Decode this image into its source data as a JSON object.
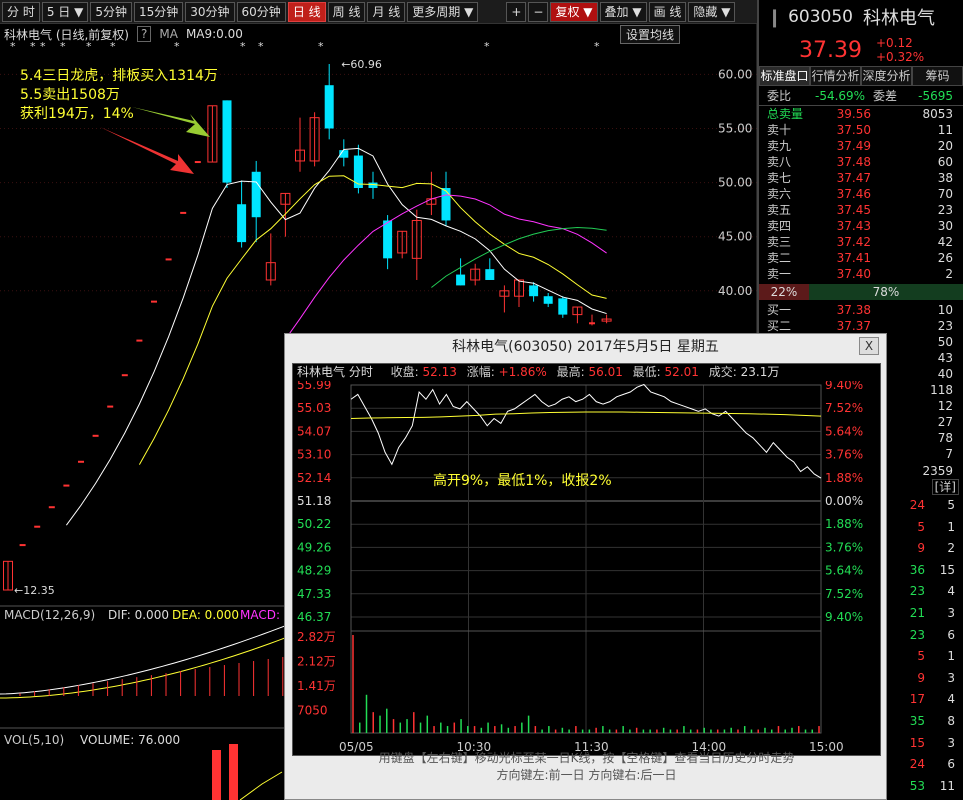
{
  "toolbar": {
    "items": [
      "分 时",
      "5 日",
      "5分钟",
      "15分钟",
      "30分钟",
      "60分钟",
      "日 线",
      "周 线",
      "月 线",
      "更多周期",
      "+",
      "−",
      "复权",
      "叠加",
      "画 线",
      "隐藏"
    ]
  },
  "chart_header": {
    "title": "科林电气 (日线,前复权)",
    "q": "?",
    "ma": "MA",
    "ma9": "MA9:0.00",
    "settings": "设置均线"
  },
  "annotation": {
    "line1": "5.4三日龙虎，排板买入1314万",
    "line2": "5.5卖出1508万",
    "line3": "获利194万，14%"
  },
  "chart_data": [
    {
      "type": "candlestick",
      "title": "科林电气 (日线,前复权)",
      "y_ticks": [
        "60.00",
        "55.00",
        "50.00",
        "45.00",
        "40.00"
      ],
      "ylim": [
        12.35,
        60.96
      ],
      "high_label": "60.96",
      "low_label": "12.35",
      "candles": [
        {
          "o": 12.35,
          "h": 15.0,
          "l": 12.35,
          "c": 15.0
        },
        {
          "o": 16.5,
          "h": 16.5,
          "l": 16.5,
          "c": 16.5
        },
        {
          "o": 18.2,
          "h": 18.2,
          "l": 18.2,
          "c": 18.2
        },
        {
          "o": 20.0,
          "h": 20.0,
          "l": 20.0,
          "c": 20.0
        },
        {
          "o": 22.0,
          "h": 22.0,
          "l": 22.0,
          "c": 22.0
        },
        {
          "o": 24.2,
          "h": 24.2,
          "l": 24.2,
          "c": 24.2
        },
        {
          "o": 26.6,
          "h": 26.6,
          "l": 26.6,
          "c": 26.6
        },
        {
          "o": 29.3,
          "h": 29.3,
          "l": 29.3,
          "c": 29.3
        },
        {
          "o": 32.2,
          "h": 32.2,
          "l": 32.2,
          "c": 32.2
        },
        {
          "o": 35.4,
          "h": 35.4,
          "l": 35.4,
          "c": 35.4
        },
        {
          "o": 39.0,
          "h": 39.0,
          "l": 39.0,
          "c": 39.0
        },
        {
          "o": 42.9,
          "h": 42.9,
          "l": 42.9,
          "c": 42.9
        },
        {
          "o": 47.2,
          "h": 47.2,
          "l": 47.2,
          "c": 47.2
        },
        {
          "o": 51.9,
          "h": 51.9,
          "l": 51.9,
          "c": 51.9
        },
        {
          "o": 51.9,
          "h": 57.1,
          "l": 51.9,
          "c": 57.1
        },
        {
          "o": 57.6,
          "h": 57.6,
          "l": 49.5,
          "c": 50.0
        },
        {
          "o": 48.0,
          "h": 50.2,
          "l": 44.0,
          "c": 44.5
        },
        {
          "o": 51.0,
          "h": 52.0,
          "l": 44.5,
          "c": 46.8
        },
        {
          "o": 41.0,
          "h": 45.3,
          "l": 40.5,
          "c": 42.6
        },
        {
          "o": 48.0,
          "h": 49.0,
          "l": 45.0,
          "c": 49.0
        },
        {
          "o": 52.0,
          "h": 56.0,
          "l": 51.0,
          "c": 53.0
        },
        {
          "o": 52.0,
          "h": 56.5,
          "l": 51.5,
          "c": 56.0
        },
        {
          "o": 59.0,
          "h": 60.96,
          "l": 54.0,
          "c": 55.0
        },
        {
          "o": 53.0,
          "h": 54.0,
          "l": 51.5,
          "c": 52.3
        },
        {
          "o": 52.5,
          "h": 53.5,
          "l": 49.0,
          "c": 49.5
        },
        {
          "o": 50.0,
          "h": 51.0,
          "l": 48.5,
          "c": 49.5
        },
        {
          "o": 46.5,
          "h": 47.0,
          "l": 42.0,
          "c": 43.0
        },
        {
          "o": 43.5,
          "h": 45.5,
          "l": 43.0,
          "c": 45.5
        },
        {
          "o": 43.0,
          "h": 47.5,
          "l": 41.0,
          "c": 46.5
        },
        {
          "o": 48.0,
          "h": 51.0,
          "l": 47.0,
          "c": 48.5
        },
        {
          "o": 49.5,
          "h": 51.0,
          "l": 46.0,
          "c": 46.5
        },
        {
          "o": 41.5,
          "h": 43.0,
          "l": 40.5,
          "c": 40.5
        },
        {
          "o": 41.0,
          "h": 42.5,
          "l": 40.5,
          "c": 42.0
        },
        {
          "o": 42.0,
          "h": 43.0,
          "l": 41.0,
          "c": 41.0
        },
        {
          "o": 39.5,
          "h": 40.5,
          "l": 38.0,
          "c": 40.0
        },
        {
          "o": 39.5,
          "h": 41.0,
          "l": 38.5,
          "c": 41.0
        },
        {
          "o": 40.5,
          "h": 40.8,
          "l": 39.0,
          "c": 39.5
        },
        {
          "o": 39.5,
          "h": 39.8,
          "l": 38.5,
          "c": 38.8
        },
        {
          "o": 39.3,
          "h": 39.5,
          "l": 37.5,
          "c": 37.8
        },
        {
          "o": 37.8,
          "h": 38.5,
          "l": 37.0,
          "c": 38.5
        },
        {
          "o": 37.0,
          "h": 37.8,
          "l": 36.8,
          "c": 37.0
        },
        {
          "o": 37.2,
          "h": 37.8,
          "l": 37.0,
          "c": 37.39
        }
      ]
    },
    {
      "type": "line",
      "title": "MACD(12,26,9)",
      "dif": "0.000",
      "dea": "0.000",
      "macd": "MACD: 0"
    },
    {
      "type": "bar",
      "title": "VOL(5,10)",
      "volume": "VOLUME: 76.000"
    },
    {
      "type": "line",
      "title": "科林电气(603050) 2017年5月5日 星期五",
      "prev_close": 51.18,
      "left_ticks": [
        "55.99",
        "55.03",
        "54.07",
        "53.10",
        "52.14",
        "51.18",
        "50.22",
        "49.26",
        "48.29",
        "47.33",
        "46.37"
      ],
      "right_ticks": [
        "9.40%",
        "7.52%",
        "5.64%",
        "3.76%",
        "1.88%",
        "0.00%",
        "1.88%",
        "3.76%",
        "5.64%",
        "7.52%",
        "9.40%"
      ],
      "vol_ticks": [
        "2.82万",
        "2.12万",
        "1.41万",
        "7050"
      ],
      "x_ticks": [
        "05/05",
        "10:30",
        "11:30",
        "14:00",
        "15:00"
      ],
      "price": [
        55.4,
        55.6,
        55.1,
        54.6,
        54.0,
        53.2,
        52.7,
        53.4,
        53.8,
        54.3,
        55.7,
        55.4,
        55.8,
        55.2,
        55.6,
        55.1,
        55.0,
        55.3,
        55.0,
        54.7,
        54.3,
        54.6,
        54.4,
        54.9,
        55.0,
        55.2,
        55.4,
        55.6,
        55.3,
        55.1,
        55.2,
        55.4,
        55.5,
        55.3,
        55.4,
        55.6,
        55.3,
        55.2,
        55.3,
        55.5,
        55.6,
        55.7,
        55.9,
        56.01,
        55.7,
        55.6,
        55.5,
        55.3,
        55.2,
        55.1,
        55.0,
        54.9,
        55.0,
        54.8,
        54.7,
        54.9,
        54.6,
        54.3,
        54.0,
        53.8,
        53.5,
        53.2,
        53.6,
        53.3,
        53.0,
        52.8,
        52.4,
        52.6,
        52.3,
        52.13
      ],
      "avg": [
        54.6,
        54.62,
        54.63,
        54.64,
        54.65,
        54.67,
        54.7,
        54.73,
        54.78,
        54.8,
        54.83,
        54.85,
        54.86,
        54.87,
        54.87,
        54.87,
        54.86,
        54.85,
        54.84,
        54.83,
        54.82,
        54.81,
        54.8,
        54.78,
        54.76,
        54.73,
        54.7
      ],
      "volume": [
        2.82,
        0.3,
        1.1,
        0.6,
        0.5,
        0.7,
        0.4,
        0.3,
        0.4,
        0.6,
        0.3,
        0.5,
        0.2,
        0.3,
        0.2,
        0.3,
        0.4,
        0.2,
        0.2,
        0.15,
        0.3,
        0.2,
        0.25,
        0.15,
        0.2,
        0.3,
        0.5,
        0.2,
        0.1,
        0.2,
        0.1,
        0.15,
        0.1,
        0.2,
        0.1,
        0.1,
        0.15,
        0.2,
        0.1,
        0.1,
        0.2,
        0.1,
        0.15,
        0.1,
        0.1,
        0.1,
        0.15,
        0.1,
        0.1,
        0.2,
        0.1,
        0.1,
        0.15,
        0.1,
        0.1,
        0.1,
        0.15,
        0.1,
        0.2,
        0.1,
        0.1,
        0.15,
        0.1,
        0.2,
        0.1,
        0.15,
        0.2,
        0.1,
        0.1,
        0.2
      ]
    }
  ],
  "popup": {
    "title": "科林电气(603050) 2017年5月5日 星期五",
    "close": "X",
    "info_name": "科林电气 分时",
    "info_close_label": "收盘:",
    "info_close": "52.13",
    "info_chg_label": "涨幅:",
    "info_chg": "+1.86%",
    "info_high_label": "最高:",
    "info_high": "56.01",
    "info_low_label": "最低:",
    "info_low": "52.01",
    "info_vol_label": "成交:",
    "info_vol": "23.1万",
    "note": "高开9%，最低1%，收报2%",
    "foot1": "用键盘【左右键】移动光标至某一日K线，按【空格键】查看当日历史分时走势",
    "foot2": "方向键左:前一日    方向键右:后一日"
  },
  "quote": {
    "code": "603050",
    "name": "科林电气",
    "price": "37.39",
    "change": "+0.12",
    "change_pct": "+0.32%",
    "tabs": [
      "标准盘口",
      "行情分析",
      "深度分析",
      "筹码"
    ],
    "weibi_label": "委比",
    "weibi": "-54.69%",
    "weicha_label": "委差",
    "weicha": "-5695",
    "total_label": "总卖量",
    "total_price": "39.56",
    "total_vol": "8053",
    "sells": [
      {
        "label": "卖十",
        "price": "37.50",
        "vol": "11"
      },
      {
        "label": "卖九",
        "price": "37.49",
        "vol": "20"
      },
      {
        "label": "卖八",
        "price": "37.48",
        "vol": "60"
      },
      {
        "label": "卖七",
        "price": "37.47",
        "vol": "38"
      },
      {
        "label": "卖六",
        "price": "37.46",
        "vol": "70"
      },
      {
        "label": "卖五",
        "price": "37.45",
        "vol": "23"
      },
      {
        "label": "卖四",
        "price": "37.43",
        "vol": "30"
      },
      {
        "label": "卖三",
        "price": "37.42",
        "vol": "42"
      },
      {
        "label": "卖二",
        "price": "37.41",
        "vol": "26"
      },
      {
        "label": "卖一",
        "price": "37.40",
        "vol": "2"
      }
    ],
    "bar_left": "22%",
    "bar_right": "78%",
    "buys": [
      {
        "label": "买一",
        "price": "37.38",
        "vol": "10"
      },
      {
        "label": "买二",
        "price": "37.37",
        "vol": "23"
      }
    ],
    "more_vols": [
      "50",
      "43",
      "40",
      "118",
      "12",
      "27",
      "78",
      "7"
    ],
    "total_buy": "2359",
    "detail": "[详]",
    "ticks": [
      {
        "v": "24",
        "n": "5",
        "c": "#ff3333"
      },
      {
        "v": "5",
        "n": "1",
        "c": "#ff3333"
      },
      {
        "v": "9",
        "n": "2",
        "c": "#ff3333"
      },
      {
        "v": "36",
        "n": "15",
        "c": "#22dd55"
      },
      {
        "v": "23",
        "n": "4",
        "c": "#22dd55"
      },
      {
        "v": "21",
        "n": "3",
        "c": "#22dd55"
      },
      {
        "v": "23",
        "n": "6",
        "c": "#22dd55"
      },
      {
        "v": "5",
        "n": "1",
        "c": "#ff3333"
      },
      {
        "v": "9",
        "n": "3",
        "c": "#ff3333"
      },
      {
        "v": "17",
        "n": "4",
        "c": "#ff3333"
      },
      {
        "v": "35",
        "n": "8",
        "c": "#22dd55"
      },
      {
        "v": "15",
        "n": "3",
        "c": "#ff3333"
      },
      {
        "v": "24",
        "n": "6",
        "c": "#ff3333"
      },
      {
        "v": "53",
        "n": "11",
        "c": "#22dd55"
      }
    ]
  },
  "colors": {
    "up": "#ff3333",
    "down": "#00e5ff",
    "ma5": "#ffffff",
    "ma10": "#ffff33",
    "ma20": "#ff33ff",
    "ma60": "#22cc55",
    "accent": "#c0201a"
  }
}
